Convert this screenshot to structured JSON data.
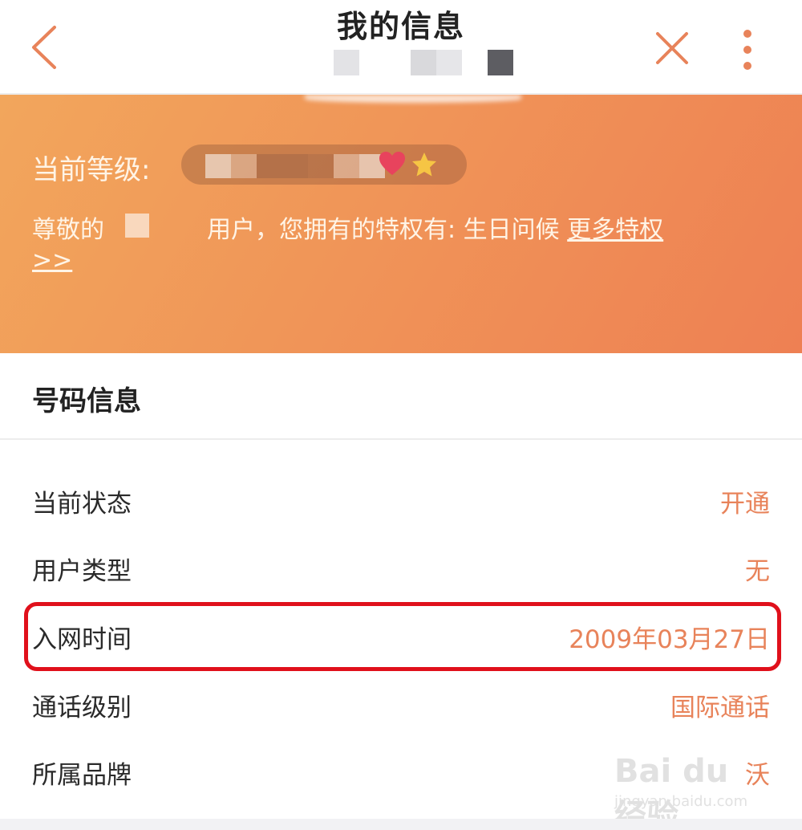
{
  "header": {
    "title": "我的信息",
    "back_icon": "chevron-left-icon",
    "close_icon": "close-icon",
    "more_icon": "more-vertical-icon",
    "accent_color": "#e8835a"
  },
  "banner": {
    "level_label": "当前等级:",
    "greeting_prefix": "尊敬的",
    "greeting_suffix": "用户，您拥有的特权有: 生日问候 ",
    "more_link": "更多特权>>",
    "gradient_start": "#f2a65c",
    "gradient_end": "#ee8053"
  },
  "section": {
    "title": "号码信息",
    "rows": [
      {
        "label": "当前状态",
        "value": "开通"
      },
      {
        "label": "用户类型",
        "value": "无"
      },
      {
        "label": "入网时间",
        "value": "2009年03月27日"
      },
      {
        "label": "通话级别",
        "value": "国际通话"
      },
      {
        "label": "所属品牌",
        "value": "沃"
      }
    ]
  },
  "annotation": {
    "highlight_color": "#e0101b"
  },
  "watermark": {
    "brand": "Bai du 经验",
    "url": "jingyan.baidu.com"
  }
}
